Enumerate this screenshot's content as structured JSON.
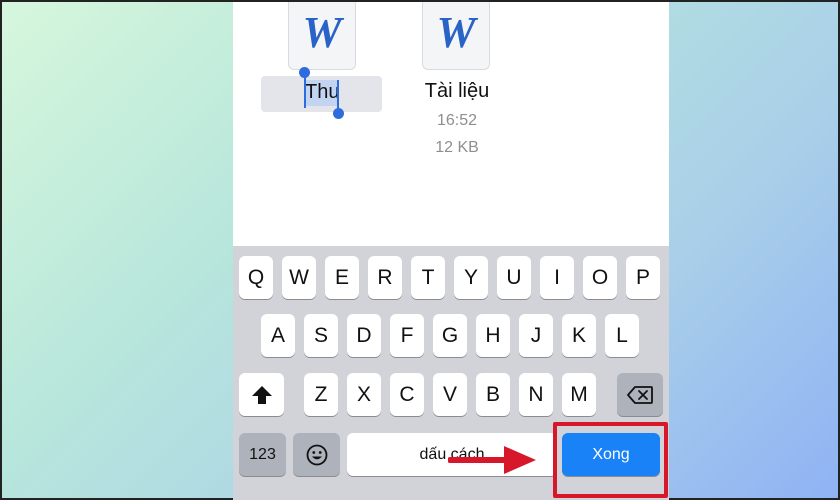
{
  "files": {
    "renaming": {
      "value": "Thu",
      "icon": "word-doc-icon"
    },
    "document": {
      "name": "Tài liệu",
      "time": "16:52",
      "size": "12 KB",
      "icon": "word-doc-icon"
    }
  },
  "keyboard": {
    "row1": [
      "Q",
      "W",
      "E",
      "R",
      "T",
      "Y",
      "U",
      "I",
      "O",
      "P"
    ],
    "row2": [
      "A",
      "S",
      "D",
      "F",
      "G",
      "H",
      "J",
      "K",
      "L"
    ],
    "row3": [
      "Z",
      "X",
      "C",
      "V",
      "B",
      "N",
      "M"
    ],
    "numbers_label": "123",
    "emoji_icon": "emoji-icon",
    "space_label": "dấu cách",
    "done_label": "Xong",
    "shift_icon": "shift-icon",
    "backspace_icon": "backspace-icon"
  },
  "annotation": {
    "highlight_color": "#d7182a",
    "arrow_icon": "right-arrow-icon"
  },
  "colors": {
    "accent": "#1a82f7",
    "selection": "#c2d4f2"
  },
  "word_letter": "W"
}
